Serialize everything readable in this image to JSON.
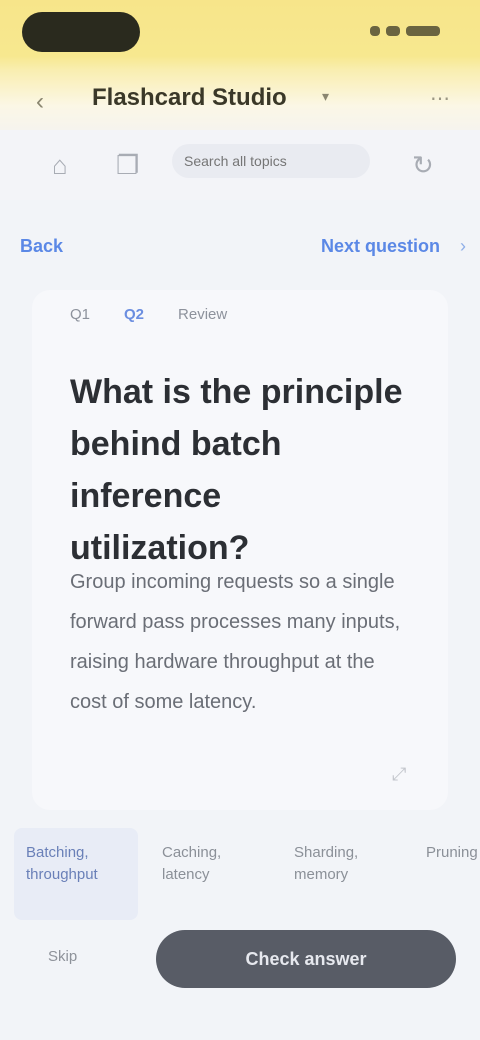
{
  "header": {
    "back_glyph": "‹",
    "title": "Flashcard Studio",
    "more_glyph": "⋯"
  },
  "toolbar": {
    "search_placeholder": "Search all topics"
  },
  "nav": {
    "prev_label": "Back",
    "next_label": "Next question"
  },
  "card": {
    "crumbs": [
      "Q1",
      "Q2",
      "Review"
    ],
    "active_crumb_index": 1,
    "headline": "What is the principle behind batch inference utilization?",
    "body": "Group incoming requests so a single forward pass processes many inputs, raising hardware throughput at the cost of some latency."
  },
  "options": [
    {
      "label": "Batching, throughput"
    },
    {
      "label": "Caching, latency"
    },
    {
      "label": "Sharding, memory"
    },
    {
      "label": "Pruning"
    }
  ],
  "footer": {
    "skip_label": "Skip",
    "cta_label": "Check answer"
  }
}
